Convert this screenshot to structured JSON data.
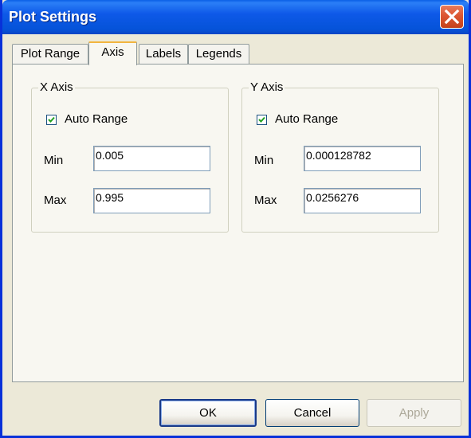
{
  "window": {
    "title": "Plot Settings"
  },
  "tabs": [
    {
      "label": "Plot Range",
      "active": false
    },
    {
      "label": "Axis",
      "active": true
    },
    {
      "label": "Labels",
      "active": false
    },
    {
      "label": "Legends",
      "active": false
    }
  ],
  "x_axis": {
    "group_label": "X Axis",
    "auto_range_label": "Auto Range",
    "auto_range_checked": true,
    "min_label": "Min",
    "min_value": "0.005",
    "max_label": "Max",
    "max_value": "0.995"
  },
  "y_axis": {
    "group_label": "Y Axis",
    "auto_range_label": "Auto Range",
    "auto_range_checked": true,
    "min_label": "Min",
    "min_value": "0.000128782",
    "max_label": "Max",
    "max_value": "0.0256276"
  },
  "buttons": {
    "ok": "OK",
    "cancel": "Cancel",
    "apply": "Apply"
  },
  "colors": {
    "titlebar": "#0553d9",
    "dialog_bg": "#ece9d8",
    "tab_accent": "#f2b53f",
    "close_button": "#dc5631"
  },
  "icons": {
    "close": "close-icon",
    "check": "check-icon"
  }
}
